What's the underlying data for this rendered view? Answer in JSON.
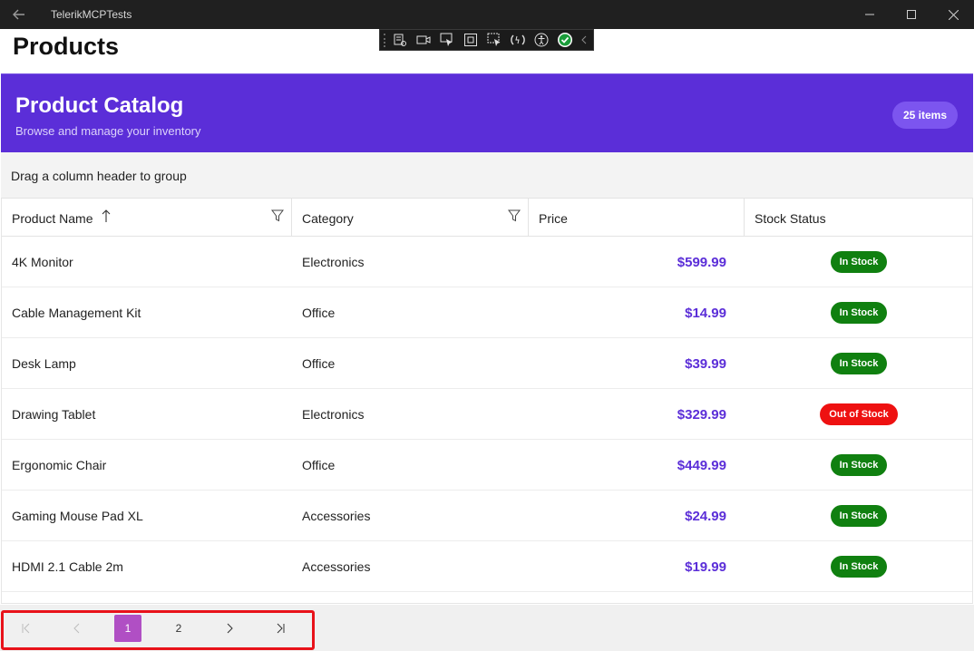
{
  "window": {
    "title": "TelerikMCPTests"
  },
  "page": {
    "heading": "Products"
  },
  "banner": {
    "title": "Product Catalog",
    "subtitle": "Browse and manage your inventory",
    "count_label": "25 items",
    "color": "#5b2ed8"
  },
  "group_panel": {
    "text": "Drag a column header to group"
  },
  "columns": [
    {
      "label": "Product Name",
      "sorted": "ascending",
      "filter": true
    },
    {
      "label": "Category",
      "filter": true
    },
    {
      "label": "Price"
    },
    {
      "label": "Stock Status"
    }
  ],
  "rows": [
    {
      "name": "4K Monitor",
      "category": "Electronics",
      "price": "$599.99",
      "stock": "In Stock"
    },
    {
      "name": "Cable Management Kit",
      "category": "Office",
      "price": "$14.99",
      "stock": "In Stock"
    },
    {
      "name": "Desk Lamp",
      "category": "Office",
      "price": "$39.99",
      "stock": "In Stock"
    },
    {
      "name": "Drawing Tablet",
      "category": "Electronics",
      "price": "$329.99",
      "stock": "Out of Stock"
    },
    {
      "name": "Ergonomic Chair",
      "category": "Office",
      "price": "$449.99",
      "stock": "In Stock"
    },
    {
      "name": "Gaming Mouse Pad XL",
      "category": "Accessories",
      "price": "$24.99",
      "stock": "In Stock"
    },
    {
      "name": "HDMI 2.1 Cable 2m",
      "category": "Accessories",
      "price": "$19.99",
      "stock": "In Stock"
    }
  ],
  "pager": {
    "pages": [
      "1",
      "2"
    ],
    "current_page": "1"
  },
  "colors": {
    "in_stock": "#108010",
    "out_of_stock": "#ee1111",
    "active_page": "#b04fc4",
    "highlight_box": "#e8121a"
  }
}
